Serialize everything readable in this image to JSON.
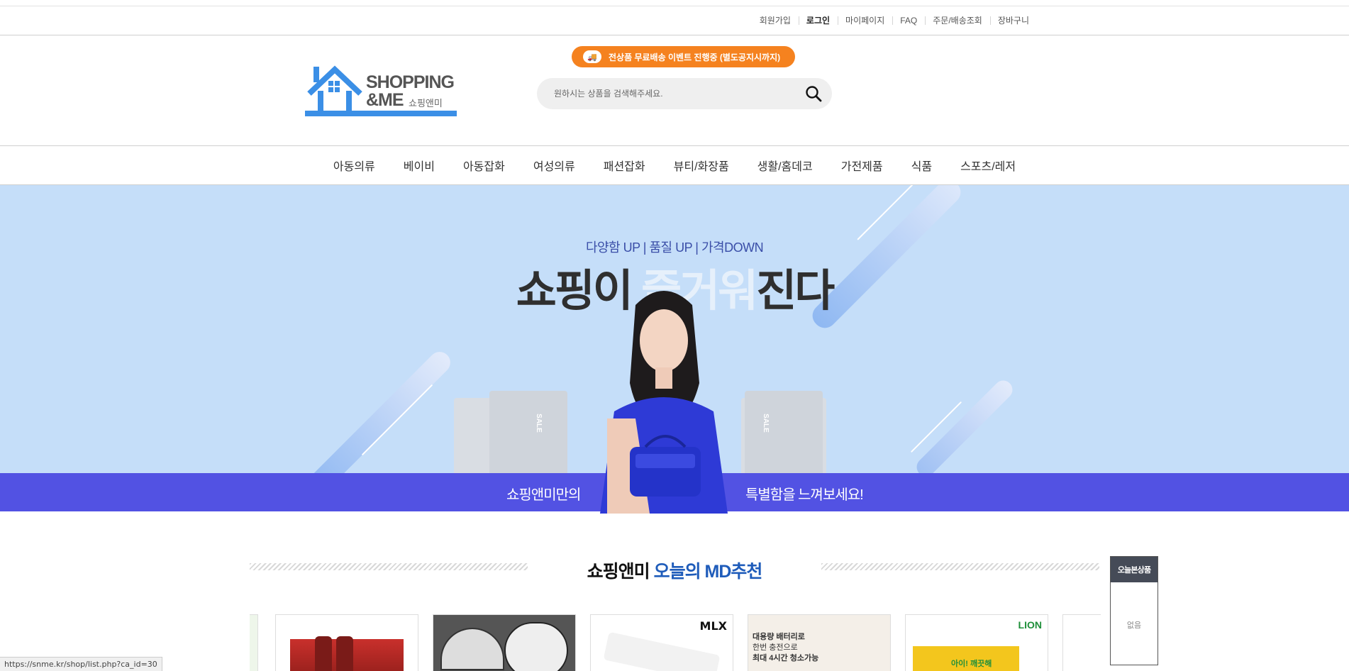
{
  "topbar": {
    "links": [
      "회원가입",
      "로그인",
      "마이페이지",
      "FAQ",
      "주문/배송조회",
      "장바구니"
    ]
  },
  "header": {
    "logo": {
      "line1": "SHOPPING",
      "line2": "&ME",
      "korean": "쇼핑앤미"
    },
    "promo": "전상품 무료배송 이벤트 진행중 (별도공지시까지)",
    "search_placeholder": "원하시는 상품을 검색해주세요."
  },
  "categories": [
    "아동의류",
    "베이비",
    "아동잡화",
    "여성의류",
    "패션잡화",
    "뷰티/화장품",
    "생활/홈데코",
    "가전제품",
    "식품",
    "스포츠/레저"
  ],
  "banner": {
    "subtitle": "다양함 UP | 품질 UP | 가격DOWN",
    "title_a": "쇼핑이 ",
    "title_b": "즐거워",
    "title_c": "진다",
    "stripe_left": "쇼핑앤미만의",
    "stripe_right": "특별함을 느껴보세요!",
    "bag_label": "SALE",
    "colors": {
      "bg": "#c5def9",
      "stripe": "#5252e3"
    }
  },
  "md_section": {
    "title_a": "쇼핑앤미 ",
    "title_b": "오늘의 MD추천",
    "product_texts": {
      "p4_brand": "MLX",
      "p5_line1": "대용량 배터리로",
      "p5_line2": "한번 충전으로",
      "p5_line3": "최대 4시간 청소가능",
      "p6_brand": "LION",
      "p6_box": "아이! 깨끗해"
    }
  },
  "recent_panel": {
    "title": "오늘본상품",
    "empty": "없음"
  },
  "status_url": "https://snme.kr/shop/list.php?ca_id=30"
}
